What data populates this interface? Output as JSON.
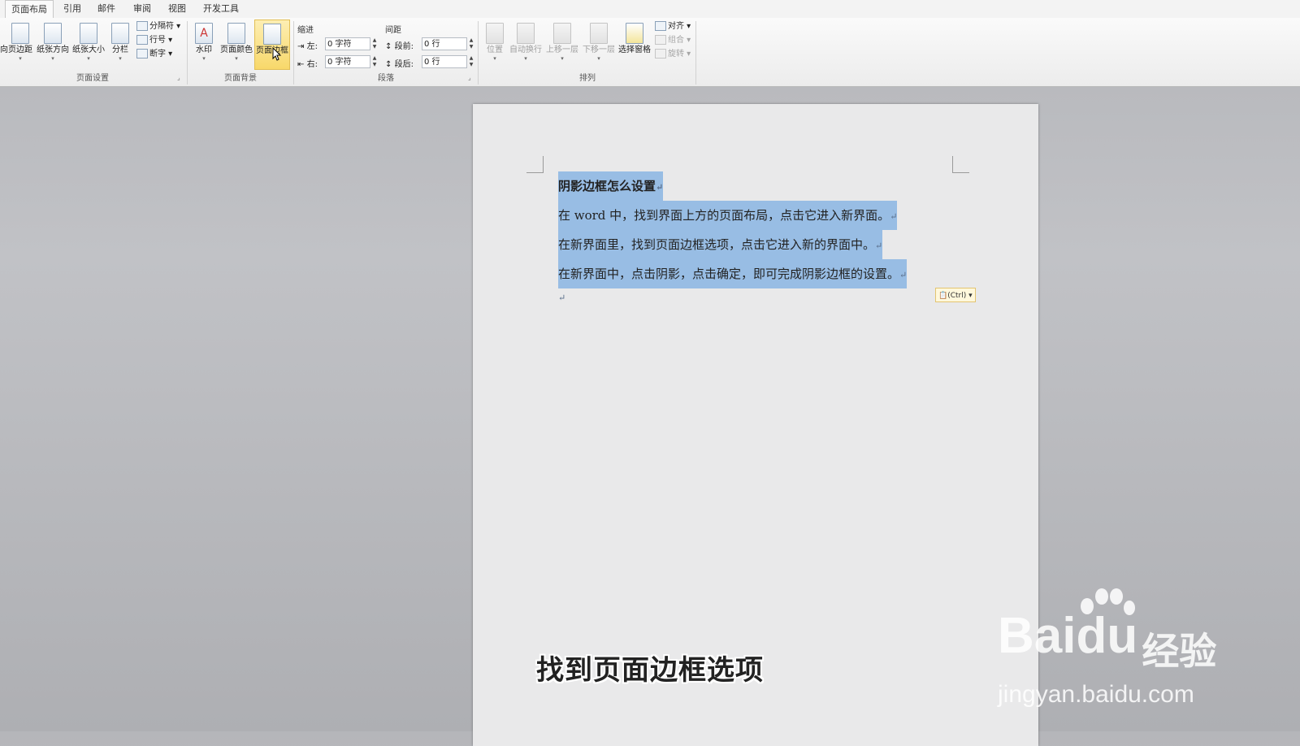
{
  "tabs": [
    "页面布局",
    "引用",
    "邮件",
    "审阅",
    "视图",
    "开发工具"
  ],
  "ribbon": {
    "page_setup": {
      "label": "页面设置",
      "cut_label": "向",
      "margins": "页边距",
      "orientation": "纸张方向",
      "size": "纸张大小",
      "columns": "分栏",
      "breaks": "分隔符",
      "line_numbers": "行号",
      "hyphenation": "断字"
    },
    "page_background": {
      "label": "页面背景",
      "watermark": "水印",
      "page_color": "页面颜色",
      "page_borders": "页面边框"
    },
    "paragraph": {
      "label": "段落",
      "indent_title": "缩进",
      "left_label": "左:",
      "left_value": "0 字符",
      "right_label": "右:",
      "right_value": "0 字符",
      "spacing_title": "间距",
      "before_label": "段前:",
      "before_value": "0 行",
      "after_label": "段后:",
      "after_value": "0 行"
    },
    "arrange": {
      "label": "排列",
      "position": "位置",
      "wrap_text": "自动换行",
      "bring_forward": "上移一层",
      "send_backward": "下移一层",
      "selection_pane": "选择窗格",
      "align": "对齐",
      "group": "组合",
      "rotate": "旋转"
    }
  },
  "document": {
    "title": "阴影边框怎么设置",
    "lines": [
      "在 word 中，找到界面上方的页面布局，点击它进入新界面。",
      "在新界面里，找到页面边框选项，点击它进入新的界面中。",
      "在新界面中，点击阴影，点击确定，即可完成阴影边框的设置。"
    ],
    "paragraph_mark": "↵",
    "paste_options": "(Ctrl)"
  },
  "caption": "找到页面边框选项",
  "watermark": {
    "brand": "Bai",
    "brand2": "du",
    "product": "经验",
    "url": "jingyan.baidu.com"
  },
  "colors": {
    "selection": "#98bde4",
    "hover_button": "#f8d86a",
    "workspace": "#b5b6ba"
  }
}
